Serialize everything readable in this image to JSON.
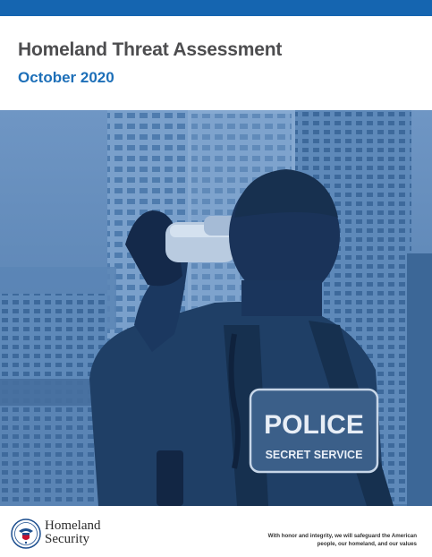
{
  "header": {
    "title": "Homeland Threat Assessment",
    "subtitle": "October 2020"
  },
  "photo": {
    "vest_text_main": "POLICE",
    "vest_text_sub": "SECRET SERVICE"
  },
  "footer": {
    "brand_line1": "Homeland",
    "brand_line2": "Security",
    "tagline_line1": "With honor and integrity, we will safeguard the American",
    "tagline_line2": "people, our homeland, and our values",
    "seal_icon": "dhs-seal-icon"
  },
  "colors": {
    "accent": "#1565b0",
    "title": "#4d4d4f",
    "subtitle": "#1d6fb8",
    "photo_tint": "#3f6fa3"
  }
}
